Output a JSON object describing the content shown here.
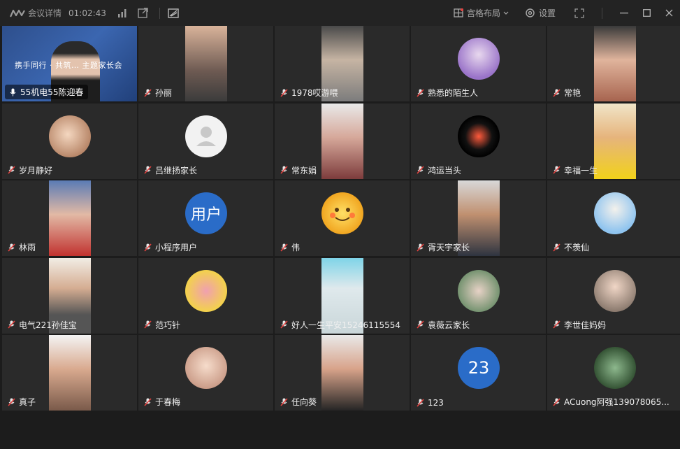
{
  "topbar": {
    "title": "会议详情",
    "time": "01:02:43",
    "layout_label": "宫格布局",
    "settings_label": "设置"
  },
  "colors": {
    "accent": "#2a6cc8",
    "tile_bg": "#2a2a2a",
    "topbar_bg": "#232323"
  },
  "participants": [
    {
      "name": "55机电55陈迎春",
      "banner": "携手同行 · 共筑… 主题家长会",
      "highlight": true
    },
    {
      "name": "孙丽"
    },
    {
      "name": "1978哎游喂"
    },
    {
      "name": "熟悉的陌生人"
    },
    {
      "name": "常艳"
    },
    {
      "name": "岁月静好"
    },
    {
      "name": "吕继扬家长"
    },
    {
      "name": "常东娟"
    },
    {
      "name": "鸿运当头"
    },
    {
      "name": "幸福一生"
    },
    {
      "name": "林雨"
    },
    {
      "name": "小程序用户",
      "avatar_text": "用户"
    },
    {
      "name": "伟"
    },
    {
      "name": "胥天宇家长"
    },
    {
      "name": "不羡仙"
    },
    {
      "name": "电气221孙佳宝"
    },
    {
      "name": "范巧针"
    },
    {
      "name": "好人一生平安15246115554"
    },
    {
      "name": "袁薇云家长"
    },
    {
      "name": "李世佳妈妈"
    },
    {
      "name": "真子"
    },
    {
      "name": "于春梅"
    },
    {
      "name": "任向葵"
    },
    {
      "name": "123",
      "avatar_text": "23"
    },
    {
      "name": "ACuong阿强139078065..."
    }
  ]
}
